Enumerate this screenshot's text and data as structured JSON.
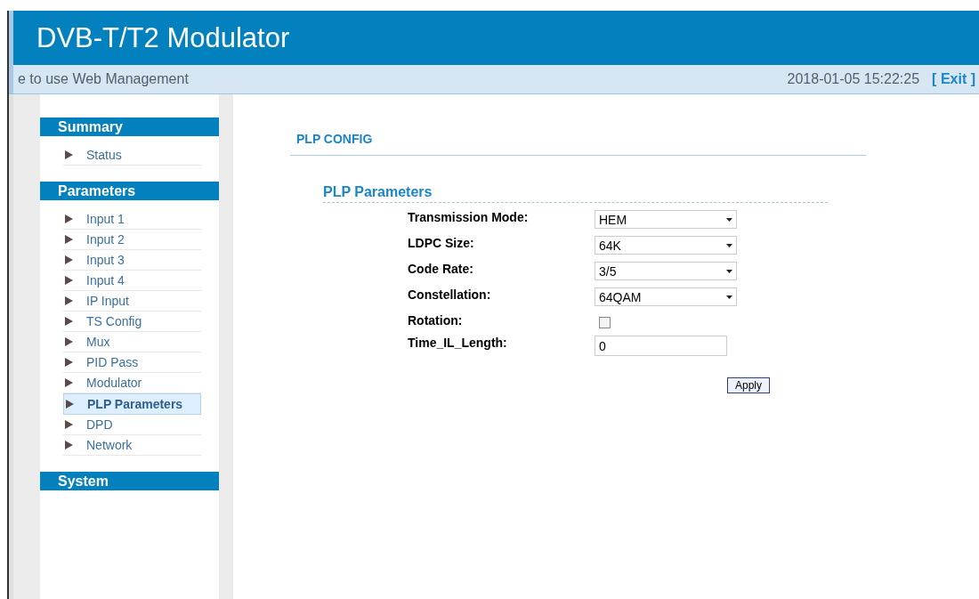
{
  "header": {
    "title": "DVB-T/T2 Modulator"
  },
  "subbar": {
    "welcome": "e to use Web Management",
    "datetime": "2018-01-05 15:22:25",
    "exit": "[ Exit ]"
  },
  "sidebar": {
    "sections": [
      {
        "title": "Summary",
        "items": [
          {
            "label": "Status",
            "selected": false
          }
        ]
      },
      {
        "title": "Parameters",
        "items": [
          {
            "label": "Input 1",
            "selected": false
          },
          {
            "label": "Input 2",
            "selected": false
          },
          {
            "label": "Input 3",
            "selected": false
          },
          {
            "label": "Input 4",
            "selected": false
          },
          {
            "label": "IP Input",
            "selected": false
          },
          {
            "label": "TS Config",
            "selected": false
          },
          {
            "label": "Mux",
            "selected": false
          },
          {
            "label": "PID Pass",
            "selected": false
          },
          {
            "label": "Modulator",
            "selected": false
          },
          {
            "label": "PLP Parameters",
            "selected": true
          },
          {
            "label": "DPD",
            "selected": false
          },
          {
            "label": "Network",
            "selected": false
          }
        ]
      },
      {
        "title": "System"
      }
    ]
  },
  "content": {
    "page_title": "PLP CONFIG",
    "section_title": "PLP Parameters",
    "fields": [
      {
        "kind": "select",
        "label": "Transmission Mode:",
        "value": "HEM"
      },
      {
        "kind": "select",
        "label": "LDPC Size:",
        "value": "64K"
      },
      {
        "kind": "select",
        "label": "Code Rate:",
        "value": "3/5"
      },
      {
        "kind": "select",
        "label": "Constellation:",
        "value": "64QAM"
      },
      {
        "kind": "checkbox",
        "label": "Rotation:",
        "checked": false
      },
      {
        "kind": "text",
        "label": "Time_IL_Length:",
        "value": "0"
      }
    ],
    "apply_button": "Apply"
  }
}
